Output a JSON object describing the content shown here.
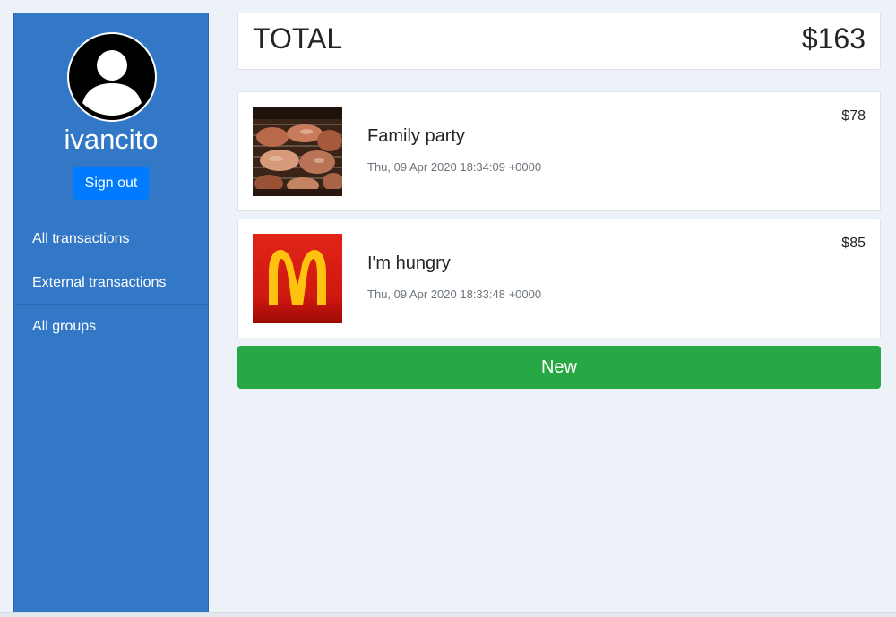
{
  "user": {
    "username": "ivancito",
    "avatar_icon": "user-circle-icon",
    "signout_label": "Sign out"
  },
  "nav": {
    "items": [
      {
        "label": "All transactions"
      },
      {
        "label": "External transactions"
      },
      {
        "label": "All groups"
      }
    ]
  },
  "summary": {
    "total_label": "TOTAL",
    "total_amount": "$163"
  },
  "transactions": [
    {
      "title": "Family party",
      "date": "Thu, 09 Apr 2020 18:34:09 +0000",
      "amount": "$78",
      "image": "grilled-meat-photo"
    },
    {
      "title": "I'm hungry",
      "date": "Thu, 09 Apr 2020 18:33:48 +0000",
      "amount": "$85",
      "image": "mcdonalds-logo"
    }
  ],
  "actions": {
    "new_label": "New"
  },
  "colors": {
    "sidebar": "#3378c7",
    "signout_button": "#007bff",
    "new_button": "#28a745",
    "background": "#edf1f8"
  }
}
